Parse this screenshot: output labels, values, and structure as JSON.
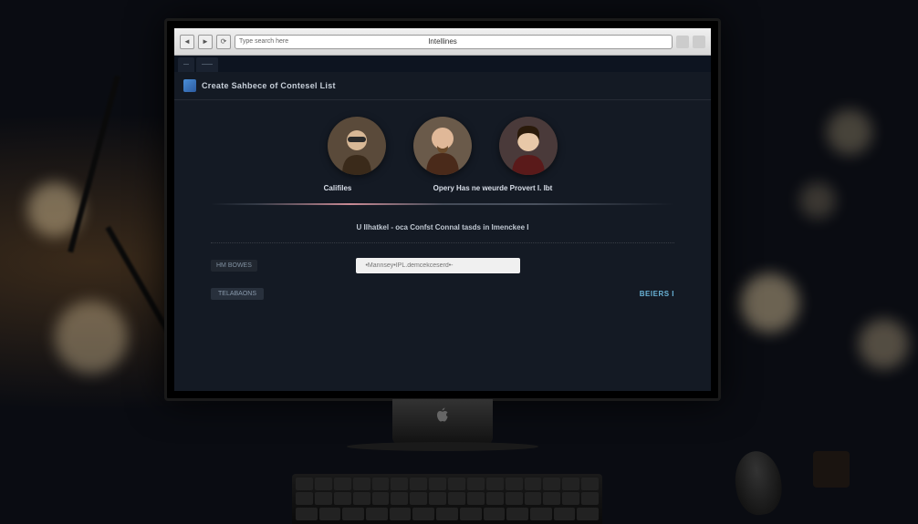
{
  "browser": {
    "title": "Intellines",
    "url_hint": "Type search here"
  },
  "tabs": [
    {
      "label": "—"
    },
    {
      "label": "——"
    }
  ],
  "header": {
    "title": "Create Sahbece of Contesel List"
  },
  "avatars": {
    "left_label": "Califiles",
    "right_label": "Opery Has ne weurde Provert I. Ibt"
  },
  "section": {
    "text": "U Ilhatkel - oca Confst Connal tasds in Imenckee I"
  },
  "row": {
    "badge_left": "HM BOWES"
  },
  "input": {
    "placeholder": "•Mannsey•IPL.demcekceserd•-"
  },
  "actions": {
    "tag": "TELABAONS",
    "button": "BEIERS I"
  }
}
